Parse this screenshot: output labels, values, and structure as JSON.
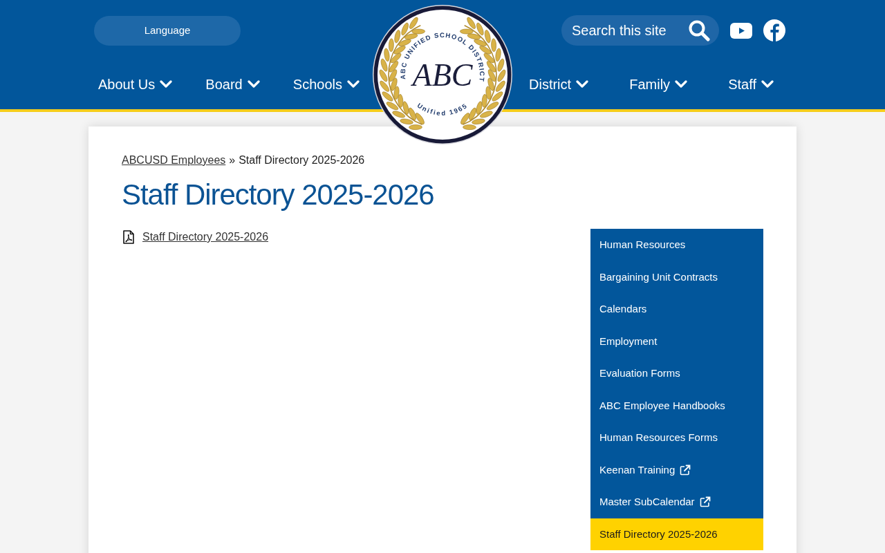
{
  "header": {
    "language_button": "Language",
    "search": {
      "placeholder": "Search this site"
    }
  },
  "logo": {
    "ring_text": "ABC UNIFIED SCHOOL DISTRICT",
    "monogram": "ABC",
    "founding_text": "Unified 1965"
  },
  "nav": {
    "left": [
      {
        "label": "About Us"
      },
      {
        "label": "Board"
      },
      {
        "label": "Schools"
      }
    ],
    "right": [
      {
        "label": "District"
      },
      {
        "label": "Family"
      },
      {
        "label": "Staff"
      }
    ]
  },
  "breadcrumb": {
    "parent": "ABCUSD Employees",
    "separator": "»",
    "current": "Staff Directory 2025-2026"
  },
  "page_title": "Staff Directory 2025-2026",
  "attachments": [
    {
      "label": "Staff Directory 2025-2026"
    }
  ],
  "sidebar": {
    "items": [
      {
        "label": "Human Resources",
        "external": false,
        "selected": false
      },
      {
        "label": "Bargaining Unit Contracts",
        "external": false,
        "selected": false
      },
      {
        "label": "Calendars",
        "external": false,
        "selected": false
      },
      {
        "label": "Employment",
        "external": false,
        "selected": false
      },
      {
        "label": "Evaluation Forms",
        "external": false,
        "selected": false
      },
      {
        "label": "ABC Employee Handbooks",
        "external": false,
        "selected": false
      },
      {
        "label": "Human Resources Forms",
        "external": false,
        "selected": false
      },
      {
        "label": "Keenan Training",
        "external": true,
        "selected": false
      },
      {
        "label": "Master SubCalendar",
        "external": true,
        "selected": false
      },
      {
        "label": "Staff Directory 2025-2026",
        "external": false,
        "selected": true
      }
    ]
  }
}
